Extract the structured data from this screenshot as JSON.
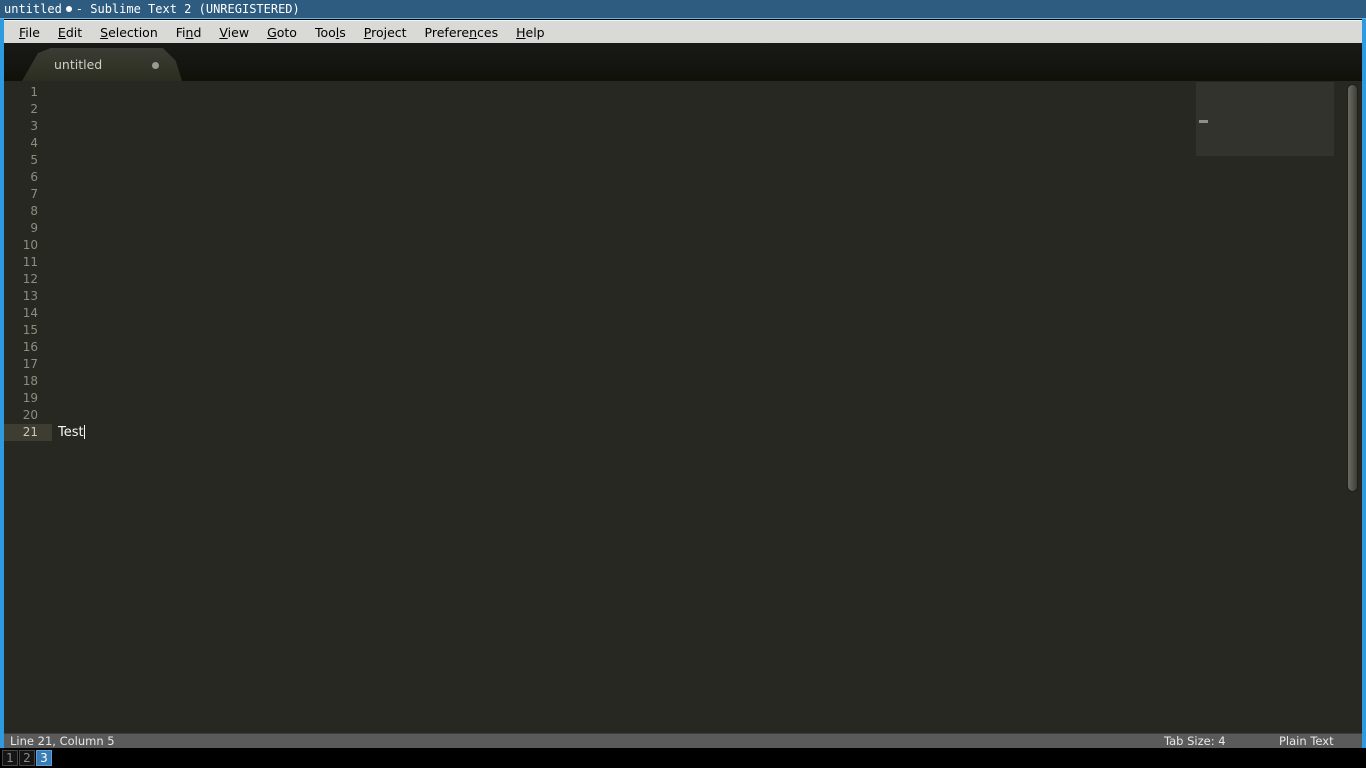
{
  "window": {
    "title_text": "untitled",
    "title_suffix": "- Sublime Text 2 (UNREGISTERED)",
    "dirty_indicator": "dirty-dot",
    "accent_border_color": "#2f9ae0",
    "titlebar_color": "#2d5c80"
  },
  "menubar": {
    "items": [
      {
        "label": "File",
        "mnemonic": "F"
      },
      {
        "label": "Edit",
        "mnemonic": "E"
      },
      {
        "label": "Selection",
        "mnemonic": "S"
      },
      {
        "label": "Find",
        "mnemonic": "n"
      },
      {
        "label": "View",
        "mnemonic": "V"
      },
      {
        "label": "Goto",
        "mnemonic": "G"
      },
      {
        "label": "Tools",
        "mnemonic": "l"
      },
      {
        "label": "Project",
        "mnemonic": "P"
      },
      {
        "label": "Preferences",
        "mnemonic": "n"
      },
      {
        "label": "Help",
        "mnemonic": "H"
      }
    ]
  },
  "tabs": [
    {
      "label": "untitled",
      "dirty": true,
      "active": true
    }
  ],
  "editor": {
    "background_color": "#272822",
    "total_lines": 21,
    "line_numbers": [
      "1",
      "2",
      "3",
      "4",
      "5",
      "6",
      "7",
      "8",
      "9",
      "10",
      "11",
      "12",
      "13",
      "14",
      "15",
      "16",
      "17",
      "18",
      "19",
      "20",
      "21"
    ],
    "lines": [
      "",
      "",
      "",
      "",
      "",
      "",
      "",
      "",
      "",
      "",
      "",
      "",
      "",
      "",
      "",
      "",
      "",
      "",
      "",
      "",
      "Test"
    ],
    "active_line": 21,
    "caret_line": 21,
    "caret_column": 5,
    "caret_text": "Test"
  },
  "minimap": {
    "viewport_visible": true,
    "marks": [
      "Test"
    ]
  },
  "scrollbar": {
    "orientation": "vertical",
    "thumb_visible": true
  },
  "statusbar": {
    "position_text": "Line 21, Column 5",
    "tab_size_text": "Tab Size: 4",
    "syntax_text": "Plain Text"
  },
  "taskbar": {
    "workspaces": [
      {
        "label": "1",
        "active": false
      },
      {
        "label": "2",
        "active": false
      },
      {
        "label": "3",
        "active": true
      }
    ]
  }
}
